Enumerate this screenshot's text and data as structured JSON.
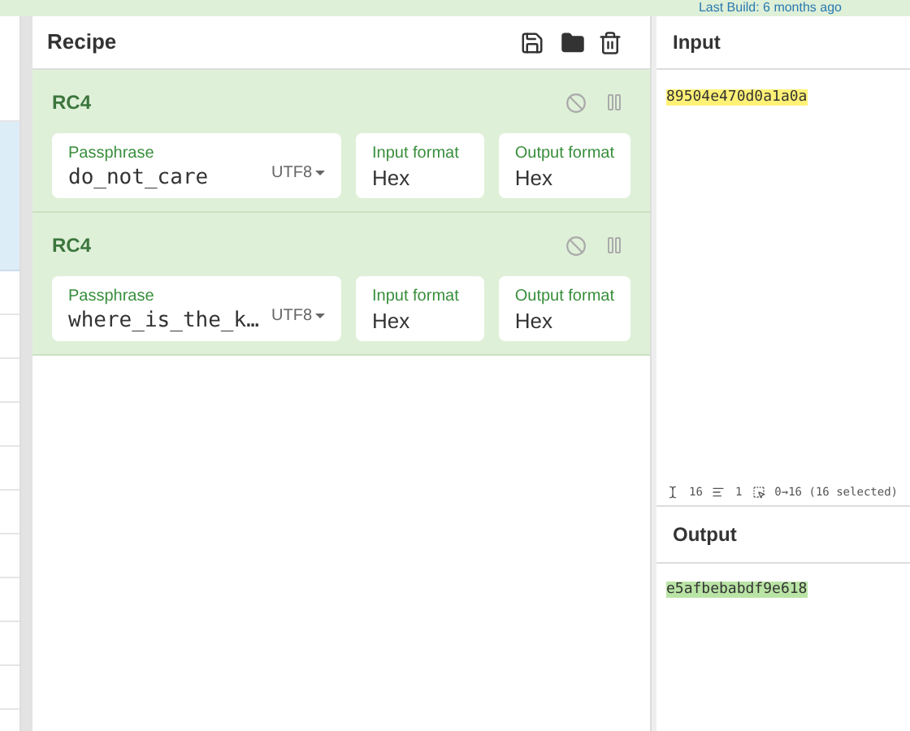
{
  "banner": {
    "text": "Last Build: 6 months ago"
  },
  "recipe": {
    "title": "Recipe",
    "operations": [
      {
        "name": "RC4",
        "disabled": false,
        "paused": false,
        "passphrase_label": "Passphrase",
        "passphrase": "do_not_care",
        "encoding": "UTF8",
        "input_label": "Input format",
        "input_value": "Hex",
        "output_label": "Output format",
        "output_value": "Hex"
      },
      {
        "name": "RC4",
        "disabled": false,
        "paused": false,
        "passphrase_label": "Passphrase",
        "passphrase": "where_is_the_k…",
        "encoding": "UTF8",
        "input_label": "Input format",
        "input_value": "Hex",
        "output_label": "Output format",
        "output_value": "Hex"
      }
    ]
  },
  "input": {
    "title": "Input",
    "value": "89504e470d0a1a0a"
  },
  "status_bar": {
    "length": "16",
    "lines": "1",
    "selection": "0→16 (16 selected)"
  },
  "output": {
    "title": "Output",
    "value": "e5afbebabdf9e618"
  }
}
